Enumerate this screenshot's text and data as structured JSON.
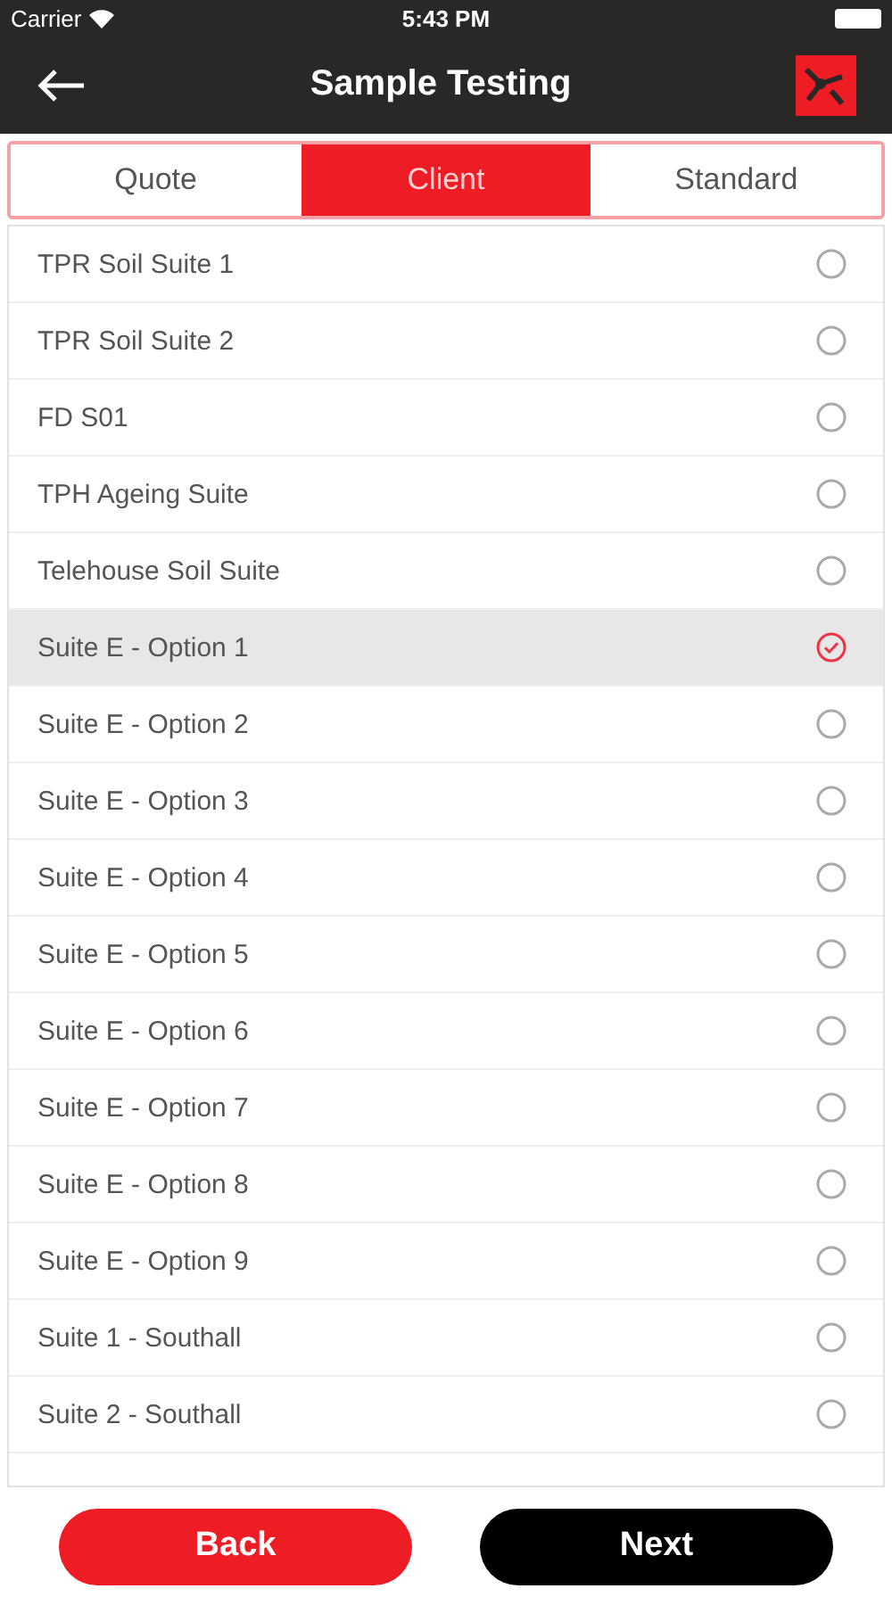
{
  "status_bar": {
    "carrier": "Carrier",
    "time": "5:43 PM"
  },
  "nav": {
    "title": "Sample Testing"
  },
  "tabs": [
    {
      "label": "Quote",
      "selected": false
    },
    {
      "label": "Client",
      "selected": true
    },
    {
      "label": "Standard",
      "selected": false
    }
  ],
  "items": [
    {
      "label": "TPR Soil Suite 1",
      "selected": false
    },
    {
      "label": "TPR Soil Suite 2",
      "selected": false
    },
    {
      "label": "FD S01",
      "selected": false
    },
    {
      "label": "TPH Ageing Suite",
      "selected": false
    },
    {
      "label": "Telehouse Soil Suite",
      "selected": false
    },
    {
      "label": "Suite E - Option 1",
      "selected": true
    },
    {
      "label": "Suite E - Option 2",
      "selected": false
    },
    {
      "label": "Suite E - Option 3",
      "selected": false
    },
    {
      "label": "Suite E - Option 4",
      "selected": false
    },
    {
      "label": "Suite E - Option 5",
      "selected": false
    },
    {
      "label": "Suite E - Option 6",
      "selected": false
    },
    {
      "label": "Suite E - Option 7",
      "selected": false
    },
    {
      "label": "Suite E - Option 8",
      "selected": false
    },
    {
      "label": "Suite E - Option 9",
      "selected": false
    },
    {
      "label": "Suite 1 - Southall",
      "selected": false
    },
    {
      "label": "Suite 2 - Southall",
      "selected": false
    }
  ],
  "buttons": [
    {
      "label": "Back",
      "kind": "secondary"
    },
    {
      "label": "Next",
      "kind": "primary"
    }
  ]
}
